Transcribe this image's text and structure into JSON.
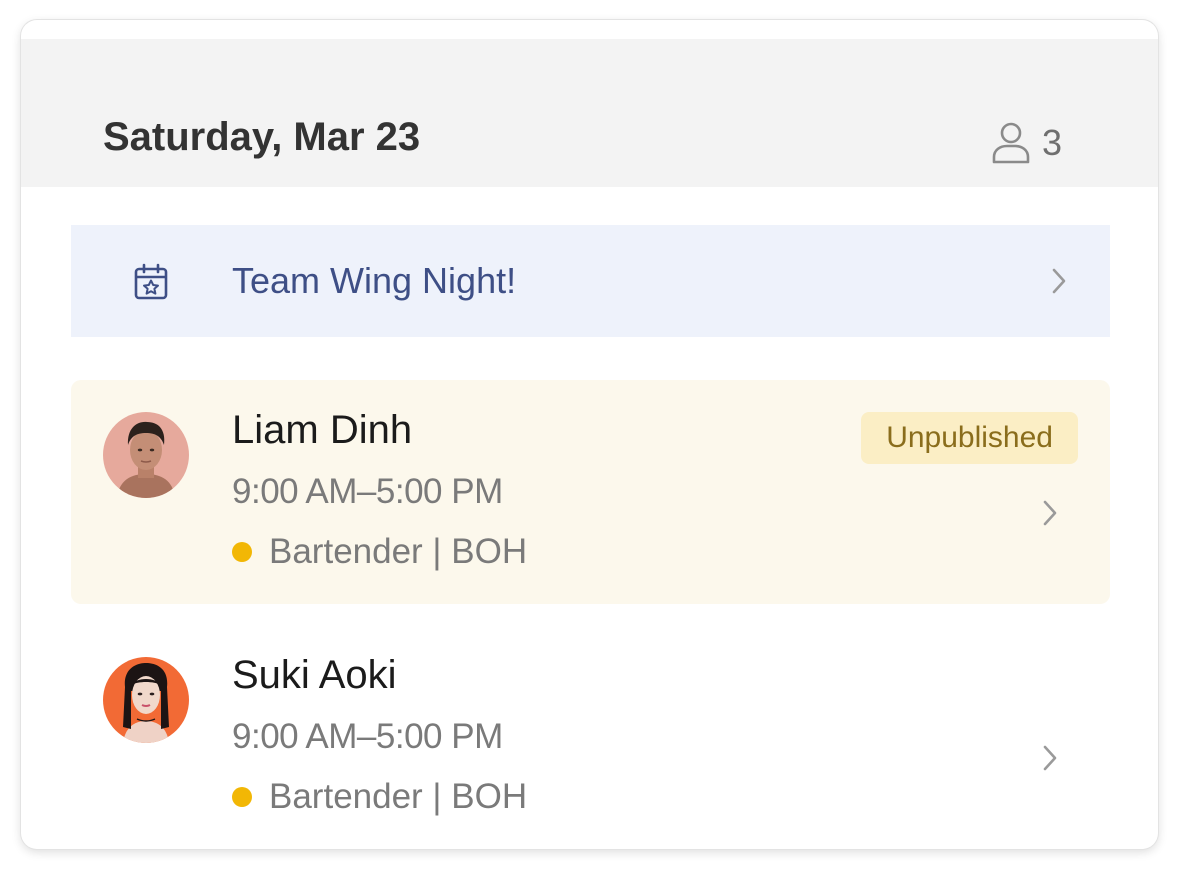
{
  "day": {
    "title": "Saturday, Mar 23",
    "staff_count": "3",
    "staff_icon": "person-icon"
  },
  "event": {
    "title": "Team Wing Night!",
    "icon": "calendar-star-icon"
  },
  "shifts": [
    {
      "name": "Liam Dinh",
      "time": "9:00 AM–5:00 PM",
      "role": "Bartender | BOH",
      "role_color": "#f2b705",
      "status": "Unpublished",
      "highlight": "#fcf8ec"
    },
    {
      "name": "Suki Aoki",
      "time": "9:00 AM–5:00 PM",
      "role": "Bartender | BOH",
      "role_color": "#f2b705"
    }
  ],
  "colors": {
    "header_bg": "#f3f3f3",
    "event_bg": "#eef2fb",
    "event_text": "#3e4f86",
    "badge_bg": "#fbeec5",
    "badge_text": "#8a6d1c"
  }
}
